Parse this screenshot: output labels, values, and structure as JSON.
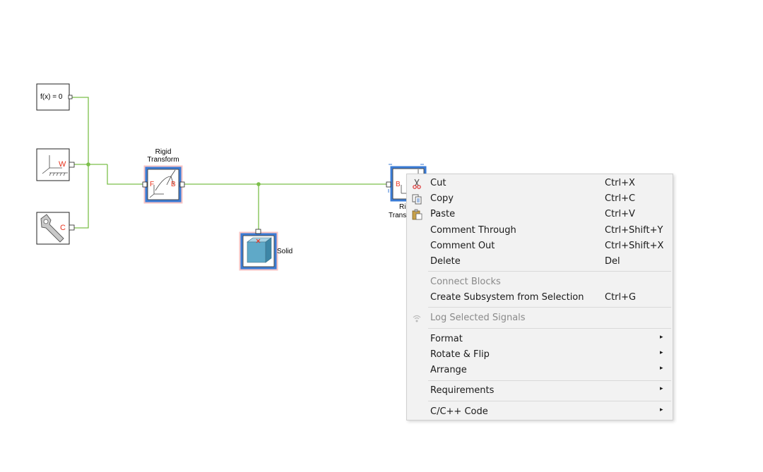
{
  "blocks": {
    "func_label": "f(x) = 0",
    "rigid_transform_label_line1": "Rigid",
    "rigid_transform_label_line2": "Transform",
    "rigid_transform_port_f": "F",
    "rigid_transform_port_b": "B",
    "world_port": "W",
    "config_port": "C",
    "solid_label": "Solid",
    "rt2_port_b": "B",
    "rt2_label_partial1": "Ri",
    "rt2_label_partial2": "Trans"
  },
  "context_menu": {
    "items": [
      {
        "label": "Cut",
        "shortcut": "Ctrl+X",
        "icon": "scissors-icon"
      },
      {
        "label": "Copy",
        "shortcut": "Ctrl+C",
        "icon": "copy-icon"
      },
      {
        "label": "Paste",
        "shortcut": "Ctrl+V",
        "icon": "paste-icon"
      },
      {
        "label": "Comment Through",
        "shortcut": "Ctrl+Shift+Y"
      },
      {
        "label": "Comment Out",
        "shortcut": "Ctrl+Shift+X"
      },
      {
        "label": "Delete",
        "shortcut": "Del"
      },
      {
        "label": "Connect Blocks",
        "disabled": true
      },
      {
        "label": "Create Subsystem from Selection",
        "shortcut": "Ctrl+G"
      },
      {
        "label": "Log Selected Signals",
        "disabled": true,
        "icon": "signal-icon"
      },
      {
        "label": "Format",
        "submenu": true
      },
      {
        "label": "Rotate & Flip",
        "submenu": true
      },
      {
        "label": "Arrange",
        "submenu": true
      },
      {
        "label": "Requirements",
        "submenu": true
      },
      {
        "label": "C/C++ Code",
        "submenu": true
      }
    ],
    "submenu_arrow": "▸"
  },
  "colors": {
    "line": "#7cbf4a",
    "selection": "#3a7bd5",
    "port_red": "#e8331e",
    "menu_bg": "#f2f2f2"
  }
}
